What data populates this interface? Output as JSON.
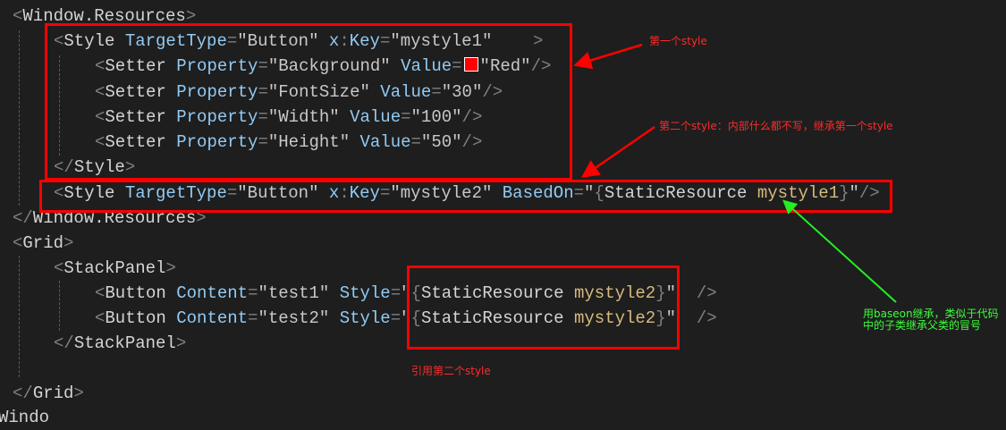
{
  "code": {
    "window_resources_open": "Window.Resources",
    "style1": {
      "element": "Style",
      "attr_targettype": "TargetType",
      "targettype": "Button",
      "attr_key_prefix": "x",
      "attr_key": "Key",
      "key": "mystyle1"
    },
    "setters": [
      {
        "element": "Setter",
        "attr_property": "Property",
        "property": "Background",
        "attr_value": "Value",
        "value": "Red",
        "swatch_color": "#ff0000"
      },
      {
        "element": "Setter",
        "attr_property": "Property",
        "property": "FontSize",
        "attr_value": "Value",
        "value": "30"
      },
      {
        "element": "Setter",
        "attr_property": "Property",
        "property": "Width",
        "attr_value": "Value",
        "value": "100"
      },
      {
        "element": "Setter",
        "attr_property": "Property",
        "property": "Height",
        "attr_value": "Value",
        "value": "50"
      }
    ],
    "style_close": "Style",
    "style2": {
      "element": "Style",
      "attr_targettype": "TargetType",
      "targettype": "Button",
      "attr_key_prefix": "x",
      "attr_key": "Key",
      "key": "mystyle2",
      "attr_basedon": "BasedOn",
      "ext": "StaticResource",
      "ref": "mystyle1"
    },
    "window_resources_close": "Window.Resources",
    "grid_open": "Grid",
    "stackpanel_open": "StackPanel",
    "buttons": [
      {
        "element": "Button",
        "attr_content": "Content",
        "content": "test1",
        "attr_style": "Style",
        "ext": "StaticResource",
        "ref": "mystyle2"
      },
      {
        "element": "Button",
        "attr_content": "Content",
        "content": "test2",
        "attr_style": "Style",
        "ext": "StaticResource",
        "ref": "mystyle2"
      }
    ],
    "stackpanel_close": "StackPanel",
    "grid_close": "Grid",
    "window_close_partial": "Windo"
  },
  "annotations": {
    "first_style": "第一个style",
    "second_style": "第二个style：内部什么都不写，继承第一个style",
    "basedon_note": "用baseon继承，类似于代码中的子类继承父类的冒号",
    "reference_second": "引用第二个style"
  },
  "colors": {
    "background": "#1e1e1e",
    "annotation_red": "#ff2a2a",
    "annotation_green": "#3cff3c"
  }
}
